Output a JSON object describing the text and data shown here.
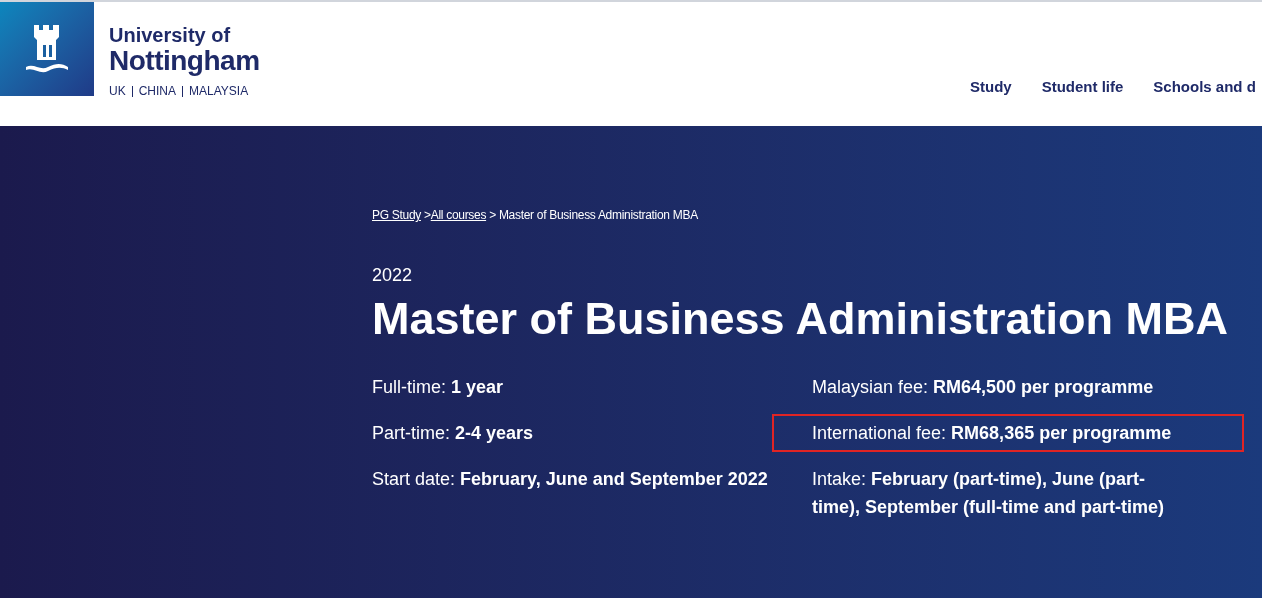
{
  "logo": {
    "line1": "University of",
    "line2": "Nottingham",
    "campuses": [
      "UK",
      "CHINA",
      "MALAYSIA"
    ]
  },
  "nav": [
    "Study",
    "Student life",
    "Schools and d"
  ],
  "breadcrumb": [
    {
      "text": "PG Study",
      "link": true
    },
    {
      "text": " >",
      "link": false
    },
    {
      "text": "All courses",
      "link": true
    },
    {
      "text": " > Master of Business Administration MBA",
      "link": false
    }
  ],
  "year": "2022",
  "title": "Master of Business Administration MBA",
  "facts_left": [
    {
      "label": "Full-time:",
      "value": "1 year",
      "highlighted": false
    },
    {
      "label": "Part-time:",
      "value": "2-4 years",
      "highlighted": false
    },
    {
      "label": "Start date:",
      "value": "February, June and September 2022",
      "highlighted": false
    }
  ],
  "facts_right": [
    {
      "label": "Malaysian fee:",
      "value": "RM64,500 per programme",
      "highlighted": false
    },
    {
      "label": "International fee:",
      "value": "RM68,365 per programme",
      "highlighted": true
    },
    {
      "label": "Intake:",
      "value": "February (part-time), June (part-time), September (full-time and part-time)",
      "highlighted": false
    }
  ]
}
